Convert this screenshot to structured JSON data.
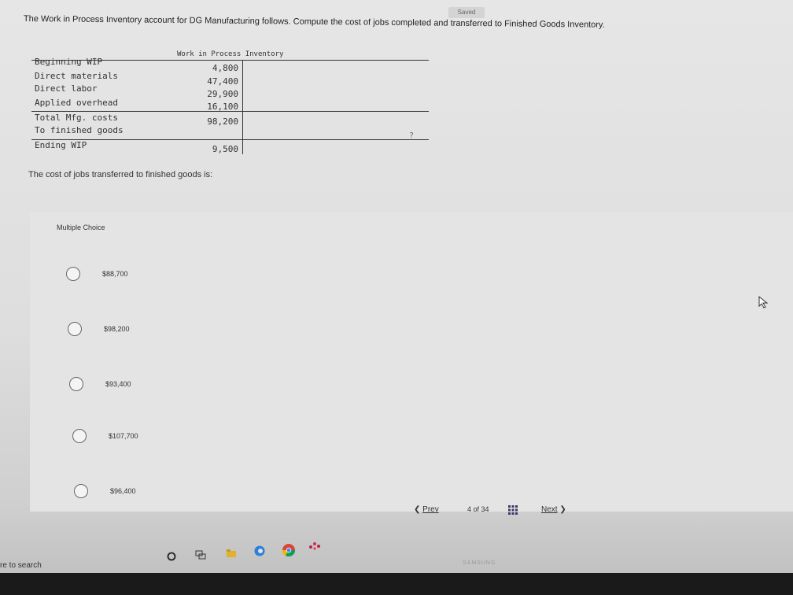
{
  "header": {
    "saved_badge": "Saved"
  },
  "question": {
    "text": "The Work in Process Inventory account for DG Manufacturing follows. Compute the cost of jobs completed and transferred to Finished Goods Inventory."
  },
  "ledger": {
    "title": "Work in Process Inventory",
    "rows": [
      {
        "label": "Beginning WIP",
        "value": "4,800"
      },
      {
        "label": "Direct materials",
        "value": "47,400"
      },
      {
        "label": "Direct labor",
        "value": "29,900"
      },
      {
        "label": "Applied overhead",
        "value": "16,100"
      },
      {
        "label": "Total Mfg. costs",
        "value": "98,200"
      },
      {
        "label": "To finished goods",
        "value": ""
      },
      {
        "label": "Ending WIP",
        "value": "9,500"
      }
    ],
    "unknown_marker": "?"
  },
  "prompt": {
    "text": "The cost of jobs transferred to finished goods is:"
  },
  "multiple_choice": {
    "label": "Multiple Choice",
    "options": [
      {
        "label": "$88,700"
      },
      {
        "label": "$98,200"
      },
      {
        "label": "$93,400"
      },
      {
        "label": "$107,700"
      },
      {
        "label": "$96,400"
      }
    ]
  },
  "pagination": {
    "prev_label": "Prev",
    "page_text": "4 of 34",
    "next_label": "Next"
  },
  "taskbar": {
    "search_text": "re to search",
    "monitor_brand": "SAMSUNG"
  },
  "colors": {
    "panel": "#e4e4e4",
    "taskbar": "#1a1a1a"
  }
}
